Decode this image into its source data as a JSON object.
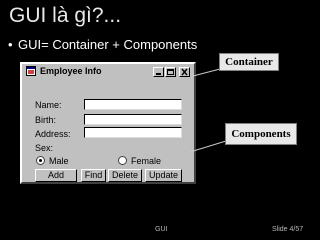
{
  "slide": {
    "title": "GUI là gì?...",
    "bullet": "GUI= Container + Components"
  },
  "window": {
    "title": "Employee Info",
    "app_icon": "app-window-icon",
    "controls": [
      "minimize-icon",
      "maximize-icon",
      "close-icon"
    ]
  },
  "form": {
    "name_label": "Name:",
    "birth_label": "Birth:",
    "address_label": "Address:",
    "sex_label": "Sex:",
    "name_value": "",
    "birth_value": "",
    "address_value": "",
    "sex_options": [
      {
        "label": "Male",
        "selected": true
      },
      {
        "label": "Female",
        "selected": false
      }
    ]
  },
  "buttons": {
    "add": "Add",
    "find": "Find",
    "delete": "Delete",
    "update": "Update"
  },
  "callouts": {
    "container": "Container",
    "components": "Components"
  },
  "footer": {
    "left": "GUI",
    "right": "Slide 4/57"
  },
  "colors": {
    "background": "#000000",
    "window_face": "#c0c0c0",
    "callout_fill": "#e8e8e8"
  }
}
